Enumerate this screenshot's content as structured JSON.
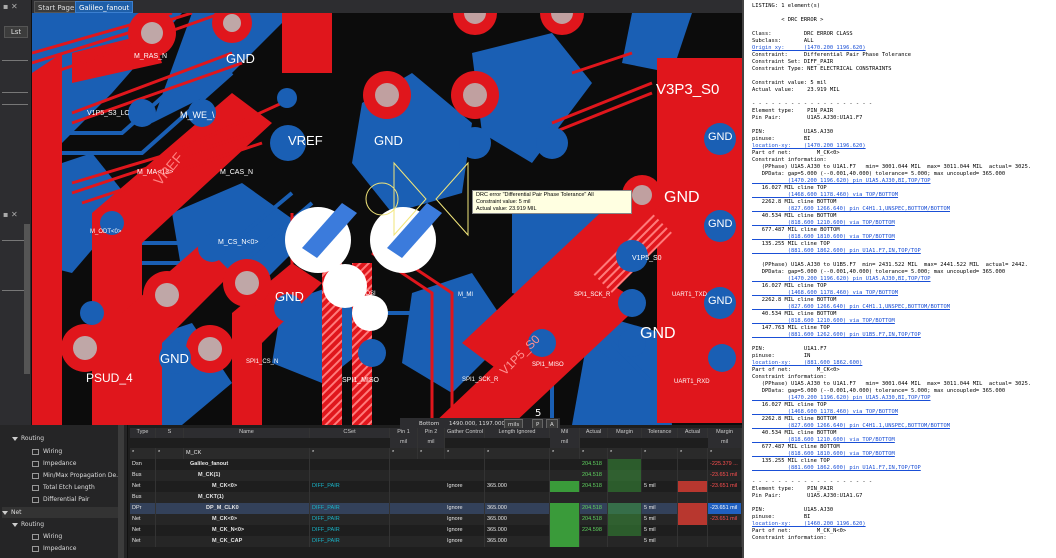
{
  "tabs": [
    {
      "label": "Start Page"
    },
    {
      "label": "Galileo_fanout"
    }
  ],
  "left_strip": {
    "button_label": "Lst"
  },
  "board": {
    "labels": {
      "gnd": "GND",
      "vref": "VREF",
      "v3p3": "V3P3_S0",
      "v1p5": "V1P5_S0",
      "v1p5_s3": "V1P5_S3_LC",
      "m_we": "M_WE_\\",
      "m_ma13": "M_MA<13>",
      "m_cas": "M_CAS_N",
      "m_cs": "M_CS_N<0>",
      "m_odt": "M_ODT<0>",
      "m_ras": "M_RAS_N",
      "m_ckn": "M_CKN",
      "spi_mosi": "SPI1_MOSI",
      "spi_miso": "SPI1_MISO",
      "spi_sck": "SPI1_SCK_R",
      "spi_cs": "SPI1_CS_N",
      "uart_txd": "UART1_TXD",
      "uart_rxd": "UART1_RXD",
      "vref_track": "VREF",
      "psud": "PSUD_4",
      "vcc": "V1P5_S0",
      "m_mi": "M_MI"
    }
  },
  "tooltip": {
    "line1": "DRC error \"Differential Pair Phase Tolerance\"   All",
    "line2": "Constraint value: 5 mil",
    "line3": "Actual value: 23.919 MIL"
  },
  "statusbar": {
    "layer": "Bottom",
    "coords": "1490.000, 1197.000",
    "units": "mils",
    "p": "P",
    "a": "A"
  },
  "tree": {
    "items": [
      {
        "label": "Routing",
        "level": 1
      },
      {
        "label": "Wiring",
        "level": 2
      },
      {
        "label": "Impedance",
        "level": 2
      },
      {
        "label": "Min/Max Propagation De...",
        "level": 2
      },
      {
        "label": "Total Etch Length",
        "level": 2
      },
      {
        "label": "Differential Pair",
        "level": 2
      },
      {
        "label": "Net",
        "level": 0
      },
      {
        "label": "Routing",
        "level": 1
      },
      {
        "label": "Wiring",
        "level": 2
      },
      {
        "label": "Impedance",
        "level": 2
      }
    ]
  },
  "grid": {
    "headers": [
      "Type",
      "S",
      "Name",
      "CSet",
      "Pin 1",
      "Pin 2",
      "Gather Control",
      "Length Ignored",
      "Mil",
      "Actual",
      "Margin",
      "Tolerance",
      "Actual",
      "Margin"
    ],
    "units": [
      "mil",
      "mil",
      "mil",
      "mil"
    ],
    "filter": [
      "*",
      "*",
      "M_CK",
      "*",
      "*",
      "*",
      "*",
      "*",
      "*",
      "*",
      "*",
      "*",
      "*",
      "*"
    ],
    "rows": [
      {
        "type": "Dsn",
        "name": "Galileo_fanout",
        "cset": "",
        "gather": "",
        "length": "",
        "actual": "",
        "margin": "204.518",
        "tol": "",
        "act2": "",
        "marg2": "-225.379 ..."
      },
      {
        "type": "Bus",
        "name": "M_CK(1)",
        "cset": "",
        "gather": "",
        "length": "",
        "actual": "",
        "margin": "204.518",
        "tol": "",
        "act2": "",
        "marg2": "-23.651 mil"
      },
      {
        "type": "Net",
        "name": "M_CK<0>",
        "cset": "DIFF_PAIR",
        "gather": "Ignore",
        "length": "365.000",
        "actual": "",
        "margin": "204.518",
        "tol": "5 mil",
        "act2": "",
        "marg2": "-23.651 mil"
      },
      {
        "type": "Bus",
        "name": "M_CKT(1)",
        "cset": "",
        "gather": "",
        "length": "",
        "actual": "",
        "margin": "",
        "tol": "",
        "act2": "",
        "marg2": ""
      },
      {
        "type": "DPr",
        "name": "DP_M_CLK0",
        "cset": "DIFF_PAIR",
        "gather": "Ignore",
        "length": "365.000",
        "actual": "",
        "margin": "204.518",
        "tol": "5 mil",
        "act2": "",
        "marg2": "-23.651 mil"
      },
      {
        "type": "Net",
        "name": "M_CK<0>",
        "cset": "DIFF_PAIR",
        "gather": "Ignore",
        "length": "365.000",
        "actual": "",
        "margin": "204.518",
        "tol": "5 mil",
        "act2": "",
        "marg2": "-23.651 mil"
      },
      {
        "type": "Net",
        "name": "M_CK_N<0>",
        "cset": "DIFF_PAIR",
        "gather": "Ignore",
        "length": "365.000",
        "actual": "",
        "margin": "224.598",
        "tol": "5 mil",
        "act2": "",
        "marg2": ""
      },
      {
        "type": "Net",
        "name": "M_CK_CAP",
        "cset": "DIFF_PAIR",
        "gather": "Ignore",
        "length": "365.000",
        "actual": "",
        "margin": "",
        "tol": "5 mil",
        "act2": "",
        "marg2": ""
      }
    ]
  },
  "report": {
    "lines": [
      "LISTING: 1 element(s)",
      "",
      "         < DRC ERROR >",
      "",
      "Class:          DRC ERROR CLASS",
      "Subclass:       ALL",
      "Origin xy:      (1470.200 1196.620)",
      "Constraint:     Differential Pair Phase Tolerance",
      "Constraint Set: DIFF_PAIR",
      "Constraint Type: NET ELECTRICAL CONSTRAINTS",
      "",
      "Constraint value: 5 mil",
      "Actual value:    23.919 MIL",
      "",
      "- - - - - - - - - - - - - - - - - - -",
      "Element type:    PIN_PAIR",
      "Pin Pair:        U1A5.AJ30:U1A1.F7",
      "",
      "PIN:            U1A5.AJ30",
      "pinuse:         BI",
      "location-xy:    (1470.200 1196.620)",
      "Part of net:        M_CK<0>",
      "Constraint information:",
      "   (PPhase) U1A5.AJ30 to U1A1.F7   min= 3001.044 MIL  max= 3011.044 MIL  actual= 3025.",
      "   DPData: gap=5.000 (--0.001,40.000) tolerance= 5.000; max uncoupled= 365.000",
      "           (1470.200 1196.620) pin U1A5.AJ30,BI,TOP/TOP",
      "   16.027 MIL cline TOP",
      "           (1468.600 1178.460) via TOP/BOTTOM",
      "   2262.8 MIL cline BOTTOM",
      "           (827.600 1266.640) pin C4H1.1,UNSPEC,BOTTOM/BOTTOM",
      "   40.534 MIL cline BOTTOM",
      "           (818.600 1210.600) via TOP/BOTTOM",
      "   677.487 MIL cline BOTTOM",
      "           (818.600 1810.600) via TOP/BOTTOM",
      "   135.255 MIL cline TOP",
      "           (881.600 1862.600) pin U1A1.F7,IN,TOP/TOP",
      "",
      "   (PPhase) U1A5.AJ30 to U1B5.F7  min= 2431.522 MIL  max= 2441.522 MIL  actual= 2442.",
      "   DPData: gap=5.000 (--0.001,40.000) tolerance= 5.000; max uncoupled= 365.000",
      "           (1470.200 1196.620) pin U1A5.AJ30,BI,TOP/TOP",
      "   16.027 MIL cline TOP",
      "           (1468.600 1178.460) via TOP/BOTTOM",
      "   2262.8 MIL cline BOTTOM",
      "           (827.600 1266.640) pin C4H1.1,UNSPEC,BOTTOM/BOTTOM",
      "   40.534 MIL cline BOTTOM",
      "           (818.600 1210.600) via TOP/BOTTOM",
      "   147.763 MIL cline TOP",
      "           (881.600 1262.600) pin U1B5.F7,IN,TOP/TOP",
      "",
      "PIN:            U1A1.F7",
      "pinuse:         IN",
      "location-xy:    (881.600 1862.600)",
      "Part of net:        M_CK<0>",
      "Constraint information:",
      "   (PPhase) U1A5.AJ30 to U1A1.F7   min= 3001.044 MIL  max= 3011.044 MIL  actual= 3025.",
      "   DPData: gap=5.000 (--0.001,40.000) tolerance= 5.000; max uncoupled= 365.000",
      "           (1470.200 1196.620) pin U1A5.AJ30,BI,TOP/TOP",
      "   16.027 MIL cline TOP",
      "           (1468.600 1178.460) via TOP/BOTTOM",
      "   2262.8 MIL cline BOTTOM",
      "           (827.600 1266.640) pin C4H1.1,UNSPEC,BOTTOM/BOTTOM",
      "   40.534 MIL cline BOTTOM",
      "           (818.600 1210.600) via TOP/BOTTOM",
      "   677.487 MIL cline BOTTOM",
      "           (818.600 1810.600) via TOP/BOTTOM",
      "   135.255 MIL cline TOP",
      "           (881.600 1862.600) pin U1A1.F7,IN,TOP/TOP",
      "",
      "- - - - - - - - - - - - - - - - - - -",
      "Element type:    PIN_PAIR",
      "Pin Pair:        U1A5.AJ30:U1A1.G7",
      "",
      "PIN:            U1A5.AJ30",
      "pinuse:         BI",
      "location-xy:    (1460.200 1196.620)",
      "Part of net:        M_CK_N<0>",
      "Constraint information:"
    ]
  }
}
